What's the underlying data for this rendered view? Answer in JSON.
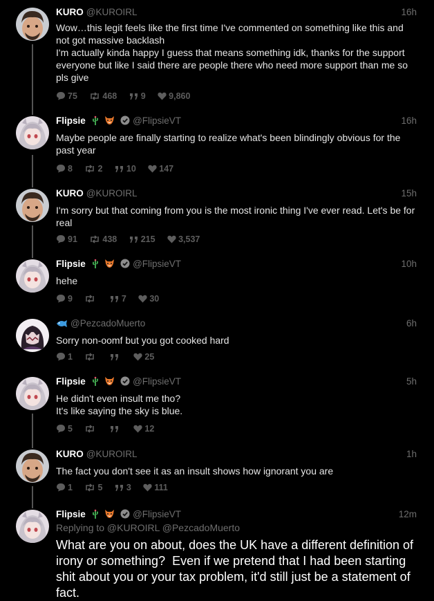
{
  "thread": {
    "tweets": [
      {
        "name": "KURO",
        "handle": "@KUROIRL",
        "time": "16h",
        "text": "Wow…this legit feels like the first time I've commented on something like this and not got massive backlash\nI'm actually kinda happy I guess that means something idk, thanks for the support everyone but like I said there are people there who need more support than me so pls give",
        "replies": "75",
        "retweets": "468",
        "quotes": "9",
        "likes": "9,860"
      },
      {
        "name": "Flipsie",
        "handle": "@FlipsieVT",
        "time": "16h",
        "text": "Maybe people are finally starting to realize what's been blindingly obvious for the past year",
        "replies": "8",
        "retweets": "2",
        "quotes": "10",
        "likes": "147"
      },
      {
        "name": "KURO",
        "handle": "@KUROIRL",
        "time": "15h",
        "text": "I'm sorry but that coming from you is the most ironic thing I've ever read. Let's be for real",
        "replies": "91",
        "retweets": "438",
        "quotes": "215",
        "likes": "3,537"
      },
      {
        "name": "Flipsie",
        "handle": "@FlipsieVT",
        "time": "10h",
        "text": "hehe",
        "replies": "9",
        "retweets": "",
        "quotes": "7",
        "likes": "30"
      },
      {
        "name": "",
        "handle": "@PezcadoMuerto",
        "time": "6h",
        "text": "Sorry non-oomf but you got cooked hard",
        "replies": "1",
        "retweets": "",
        "quotes": "",
        "likes": "25"
      },
      {
        "name": "Flipsie",
        "handle": "@FlipsieVT",
        "time": "5h",
        "text": "He didn't even insult me tho?\nIt's like saying the sky is blue.",
        "replies": "5",
        "retweets": "",
        "quotes": "",
        "likes": "12"
      },
      {
        "name": "KURO",
        "handle": "@KUROIRL",
        "time": "1h",
        "text": "The fact you don't see it as an insult shows how ignorant you are",
        "replies": "1",
        "retweets": "5",
        "quotes": "3",
        "likes": "111"
      },
      {
        "name": "Flipsie",
        "handle": "@FlipsieVT",
        "time": "12m",
        "replying_to": "Replying to @KUROIRL @PezcadoMuerto",
        "text": "What are you on about, does the UK have a different definition of irony or something?  Even if we pretend that I had been starting shit about you or your tax problem, it'd still just be a statement of fact."
      }
    ]
  },
  "colors": {
    "background": "#000000",
    "text": "#e6e6e6",
    "muted": "#6e6e6e",
    "action": "#5d5d5d",
    "thread_line": "#545454",
    "name": "#ffffff"
  },
  "icons": {
    "reply": "speech-bubble-icon",
    "retweet": "retweet-arrows-icon",
    "quote": "quote-marks-icon",
    "like": "heart-icon",
    "verified": "verified-check-icon",
    "flipsie_emoji_1": "cactus-emoji",
    "flipsie_emoji_2": "fox-emoji",
    "pezcado_emoji": "fish-emoji"
  }
}
